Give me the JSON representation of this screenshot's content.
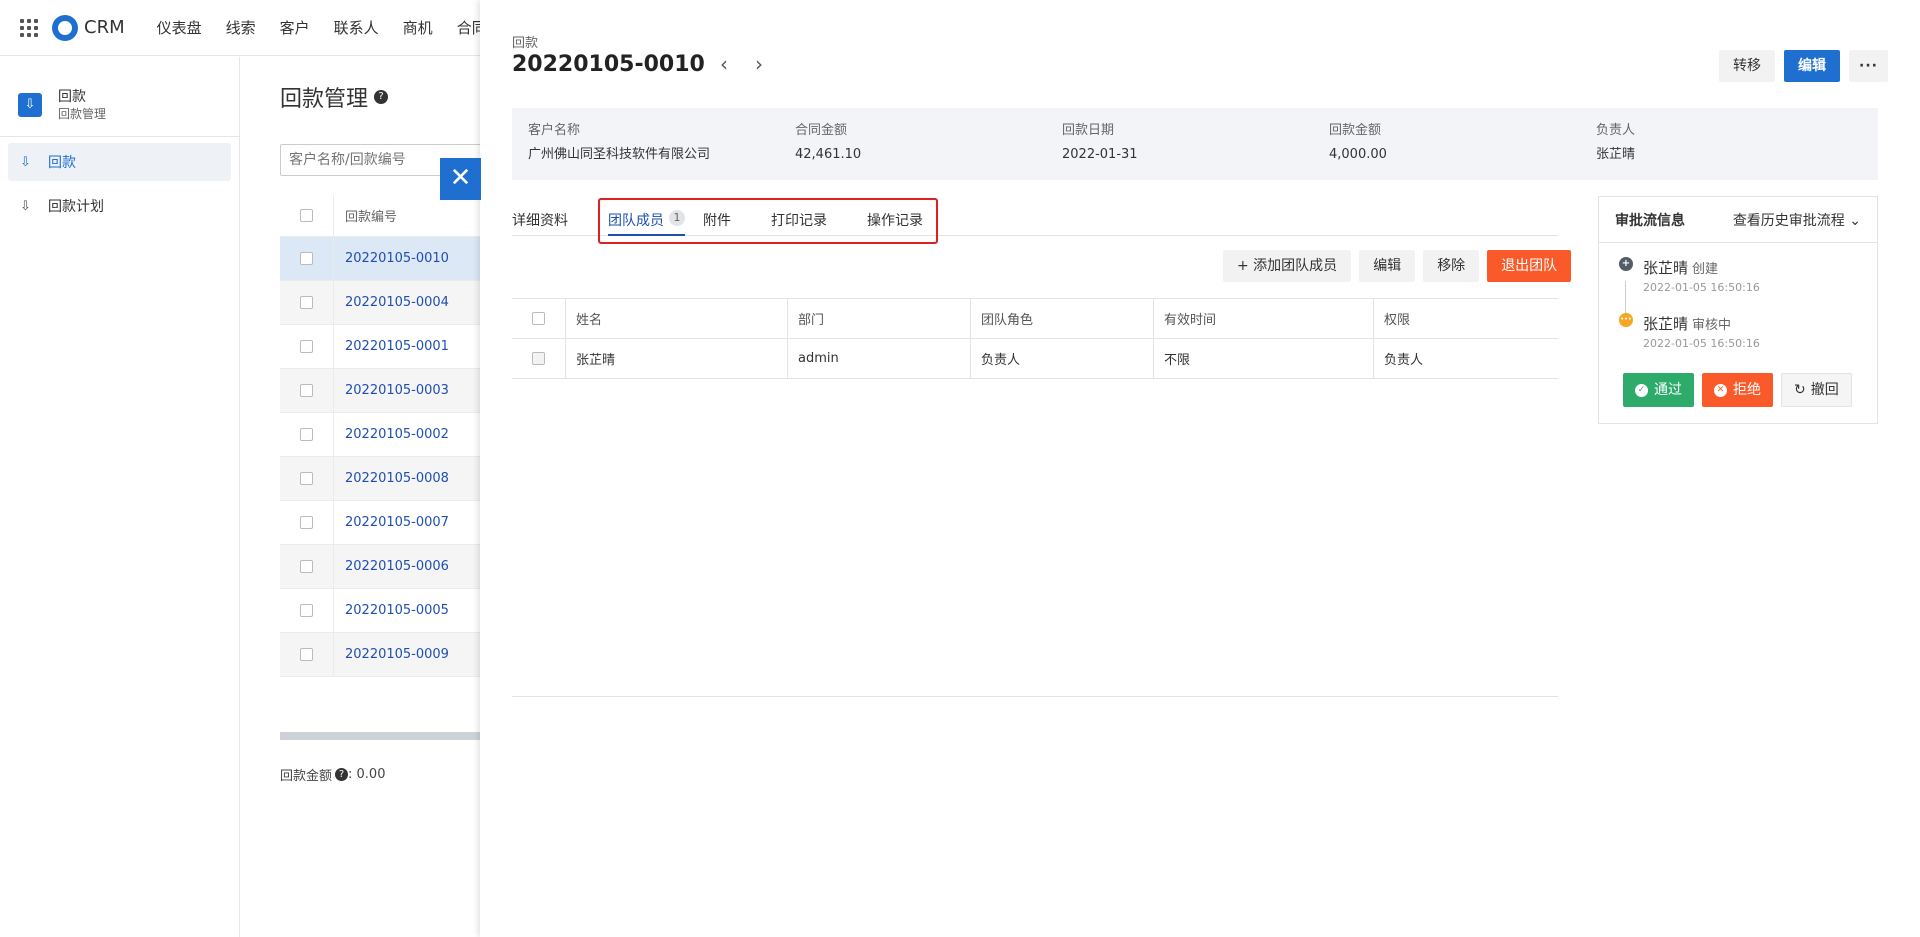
{
  "app": {
    "logo_text": "CRM"
  },
  "topnav": {
    "items": [
      "仪表盘",
      "线索",
      "客户",
      "联系人",
      "商机",
      "合同"
    ]
  },
  "sidebar": {
    "module_title": "回款",
    "module_subtitle": "回款管理",
    "items": [
      {
        "label": "回款",
        "active": true
      },
      {
        "label": "回款计划",
        "active": false
      }
    ]
  },
  "list": {
    "title": "回款管理",
    "search_placeholder": "客户名称/回款编号",
    "column_header": "回款编号",
    "rows": [
      "20220105-0010",
      "20220105-0004",
      "20220105-0001",
      "20220105-0003",
      "20220105-0002",
      "20220105-0008",
      "20220105-0007",
      "20220105-0006",
      "20220105-0005",
      "20220105-0009"
    ],
    "summary_label": "回款金额",
    "summary_value": ": 0.00"
  },
  "detail": {
    "type_label": "回款",
    "code": "20220105-0010",
    "actions": {
      "transfer": "转移",
      "edit": "编辑",
      "more": "···"
    },
    "summary": [
      {
        "label": "客户名称",
        "value": "广州佛山同圣科技软件有限公司"
      },
      {
        "label": "合同金额",
        "value": "42,461.10"
      },
      {
        "label": "回款日期",
        "value": "2022-01-31"
      },
      {
        "label": "回款金额",
        "value": "4,000.00"
      },
      {
        "label": "负责人",
        "value": "张芷晴"
      }
    ],
    "tabs": [
      {
        "label": "详细资料"
      },
      {
        "label": "团队成员",
        "badge": "1",
        "active": true
      },
      {
        "label": "附件"
      },
      {
        "label": "打印记录"
      },
      {
        "label": "操作记录"
      }
    ],
    "team_actions": {
      "add": "+ 添加团队成员",
      "edit": "编辑",
      "remove": "移除",
      "exit": "退出团队"
    },
    "team_table": {
      "headers": [
        "姓名",
        "部门",
        "团队角色",
        "有效时间",
        "权限"
      ],
      "rows": [
        [
          "张芷晴",
          "admin",
          "负责人",
          "不限",
          "负责人"
        ]
      ]
    }
  },
  "approval": {
    "title": "审批流信息",
    "history_label": "查看历史审批流程",
    "steps": [
      {
        "name": "张芷晴",
        "status": "创建",
        "time": "2022-01-05 16:50:16",
        "color": "#555c66"
      },
      {
        "name": "张芷晴",
        "status": "审核中",
        "time": "2022-01-05 16:50:16",
        "color": "#f5a623"
      }
    ],
    "buttons": {
      "pass": "通过",
      "reject": "拒绝",
      "revoke": "撤回"
    }
  },
  "colors": {
    "primary": "#1f6fd1",
    "danger": "#fa5a2a",
    "success": "#2cab6b"
  }
}
